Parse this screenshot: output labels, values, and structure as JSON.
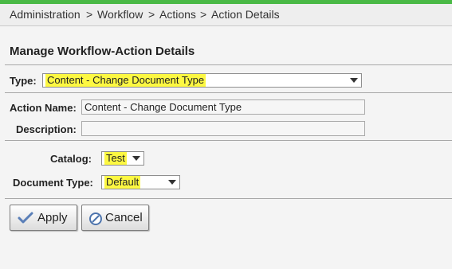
{
  "breadcrumb": {
    "items": [
      "Administration",
      "Workflow",
      "Actions",
      "Action Details"
    ],
    "separator": ">"
  },
  "page": {
    "title": "Manage Workflow-Action Details"
  },
  "form": {
    "type_label": "Type:",
    "type_value": "Content - Change Document Type",
    "action_name_label": "Action Name:",
    "action_name_value": "Content - Change Document Type",
    "description_label": "Description:",
    "description_value": "",
    "catalog_label": "Catalog:",
    "catalog_value": "Test",
    "document_type_label": "Document Type:",
    "document_type_value": "Default"
  },
  "buttons": {
    "apply_label": "Apply",
    "cancel_label": "Cancel"
  },
  "colors": {
    "accent": "#4ab946",
    "highlight": "#fdf842"
  }
}
